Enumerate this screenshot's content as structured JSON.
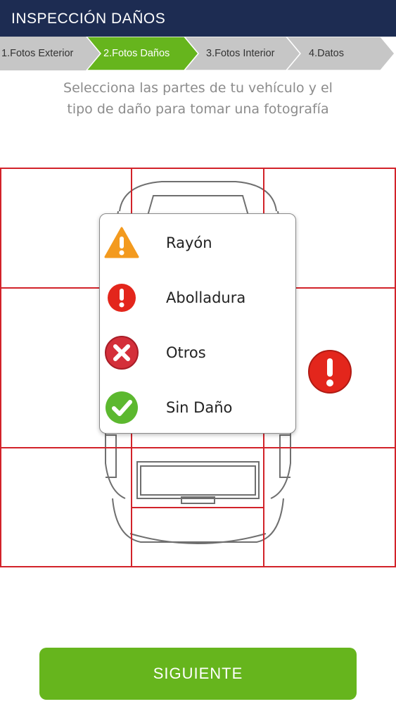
{
  "header": {
    "title": "INSPECCIÓN DAÑOS"
  },
  "steps": [
    {
      "label": "1.Fotos Exterior",
      "active": false
    },
    {
      "label": "2.Fotos Daños",
      "active": true
    },
    {
      "label": "3.Fotos Interior",
      "active": false
    },
    {
      "label": "4.Datos",
      "active": false
    }
  ],
  "instructions": {
    "line1": "Selecciona las partes de tu vehículo y el",
    "line2": "tipo de daño para tomar una fotografía"
  },
  "damage_menu": {
    "options": [
      {
        "label": "Rayón",
        "icon": "warning-triangle-icon"
      },
      {
        "label": "Abolladura",
        "icon": "exclamation-circle-icon"
      },
      {
        "label": "Otros",
        "icon": "x-circle-icon"
      },
      {
        "label": "Sin Daño",
        "icon": "check-circle-icon"
      }
    ]
  },
  "marker": {
    "icon": "exclamation-circle-icon"
  },
  "footer": {
    "next_label": "SIGUIENTE"
  },
  "colors": {
    "header_bg": "#1d2c52",
    "step_active": "#66b51d",
    "step_inactive": "#c6c6c6",
    "grid_line": "#d2232a",
    "warning": "#f39a1e",
    "danger": "#e3261c",
    "success": "#5cb82f",
    "button": "#66b51d"
  }
}
